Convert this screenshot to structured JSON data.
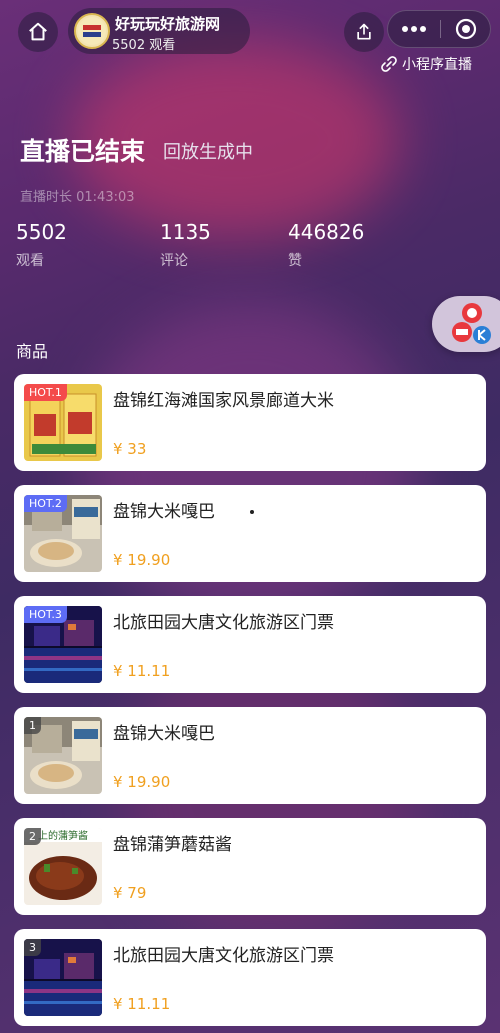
{
  "header": {
    "host_name": "好玩玩好旅游网",
    "viewer_line": "5502 观看",
    "avatar_text": "好玩玩好旅游网"
  },
  "mini_program_live": "小程序直播",
  "status": {
    "title": "直播已结束",
    "replay": "回放生成中",
    "duration": "直播时长 01:43:03"
  },
  "stats": [
    {
      "value": "5502",
      "label": "观看"
    },
    {
      "value": "1135",
      "label": "评论"
    },
    {
      "value": "446826",
      "label": "赞"
    }
  ],
  "section_title": "商品",
  "products": [
    {
      "badge": "HOT.1",
      "badge_type": "hot-red",
      "name": "盘锦红海滩国家风景廊道大米",
      "price": "¥ 33",
      "thumb": "rice"
    },
    {
      "badge": "HOT.2",
      "badge_type": "hot-blue",
      "name": "盘锦大米嘎巴",
      "price": "¥ 19.90",
      "thumb": "crust"
    },
    {
      "badge": "HOT.3",
      "badge_type": "hot-blue",
      "name": "北旅田园大唐文化旅游区门票",
      "price": "¥ 11.11",
      "thumb": "night"
    },
    {
      "badge": "1",
      "badge_type": "num",
      "name": "盘锦大米嘎巴",
      "price": "¥ 19.90",
      "thumb": "crust"
    },
    {
      "badge": "2",
      "badge_type": "num",
      "name": "盘锦蒲笋蘑菇酱",
      "price": "¥ 79",
      "thumb": "sauce",
      "thumb_text": "上的蒲笋酱"
    },
    {
      "badge": "3",
      "badge_type": "num",
      "name": "北旅田园大唐文化旅游区门票",
      "price": "¥ 11.11",
      "thumb": "night"
    }
  ],
  "colors": {
    "price": "#f0a020",
    "hot_red": "#f44b4b",
    "hot_blue": "#5d6cf5"
  }
}
